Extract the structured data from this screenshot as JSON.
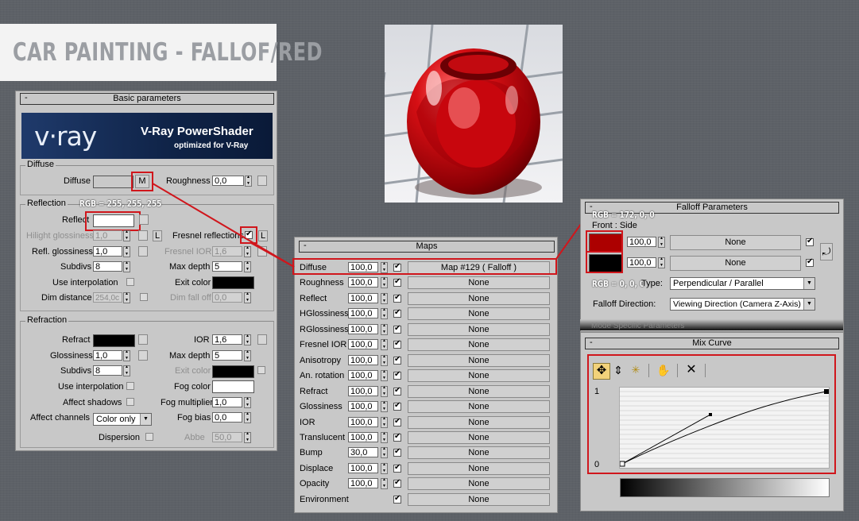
{
  "page_title": "CAR PAINTING - FALLOF/RED",
  "basic": {
    "header": "Basic parameters",
    "collapse": "-",
    "banner": {
      "logo": "v·ray",
      "title": "V-Ray PowerShader",
      "subtitle": "optimized for V-Ray"
    },
    "diffuse": {
      "group": "Diffuse",
      "label": "Diffuse",
      "map_btn": "M",
      "roughness_label": "Roughness",
      "roughness": "0,0"
    },
    "reflection": {
      "group": "Reflection",
      "rgb_note": "RGB = 255, 255, 255",
      "reflect_label": "Reflect",
      "hilight_label": "Hilight glossiness",
      "hilight": "1,0",
      "lock": "L",
      "fresnel_label": "Fresnel reflections",
      "fresnel_lock": "L",
      "refl_gloss_label": "Refl. glossiness",
      "refl_gloss": "1,0",
      "fresnel_ior_label": "Fresnel IOR",
      "fresnel_ior": "1,6",
      "subdivs_label": "Subdivs",
      "subdivs": "8",
      "max_depth_label": "Max depth",
      "max_depth": "5",
      "use_interp_label": "Use interpolation",
      "exit_color_label": "Exit color",
      "dim_dist_label": "Dim distance",
      "dim_dist": "254,0c",
      "dim_falloff_label": "Dim fall off",
      "dim_falloff": "0,0"
    },
    "refraction": {
      "group": "Refraction",
      "refract_label": "Refract",
      "ior_label": "IOR",
      "ior": "1,6",
      "gloss_label": "Glossiness",
      "gloss": "1,0",
      "max_depth_label": "Max depth",
      "max_depth": "5",
      "subdivs_label": "Subdivs",
      "subdivs": "8",
      "exit_color_label": "Exit color",
      "use_interp_label": "Use interpolation",
      "fog_color_label": "Fog color",
      "affect_shadows_label": "Affect shadows",
      "fog_mult_label": "Fog multiplier",
      "fog_mult": "1,0",
      "affect_channels_label": "Affect channels",
      "affect_channels": "Color only",
      "fog_bias_label": "Fog bias",
      "fog_bias": "0,0",
      "dispersion_label": "Dispersion",
      "abbe_label": "Abbe",
      "abbe": "50,0"
    }
  },
  "maps": {
    "header": "Maps",
    "collapse": "-",
    "rows": [
      {
        "label": "Diffuse",
        "amount": "100,0",
        "map": "Map #129  ( Falloff )"
      },
      {
        "label": "Roughness",
        "amount": "100,0",
        "map": "None"
      },
      {
        "label": "Reflect",
        "amount": "100,0",
        "map": "None"
      },
      {
        "label": "HGlossiness",
        "amount": "100,0",
        "map": "None"
      },
      {
        "label": "RGlossiness",
        "amount": "100,0",
        "map": "None"
      },
      {
        "label": "Fresnel IOR",
        "amount": "100,0",
        "map": "None"
      },
      {
        "label": "Anisotropy",
        "amount": "100,0",
        "map": "None"
      },
      {
        "label": "An. rotation",
        "amount": "100,0",
        "map": "None"
      },
      {
        "label": "Refract",
        "amount": "100,0",
        "map": "None"
      },
      {
        "label": "Glossiness",
        "amount": "100,0",
        "map": "None"
      },
      {
        "label": "IOR",
        "amount": "100,0",
        "map": "None"
      },
      {
        "label": "Translucent",
        "amount": "100,0",
        "map": "None"
      },
      {
        "label": "Bump",
        "amount": "30,0",
        "map": "None"
      },
      {
        "label": "Displace",
        "amount": "100,0",
        "map": "None"
      },
      {
        "label": "Opacity",
        "amount": "100,0",
        "map": "None"
      },
      {
        "label": "Environment",
        "amount": "",
        "map": "None"
      }
    ]
  },
  "falloff": {
    "header": "Falloff Parameters",
    "collapse": "-",
    "rgb_note_top": "RGB = 172, 0, 0",
    "front_side_label": "Front : Side",
    "front_amount": "100,0",
    "front_map": "None",
    "side_amount": "100,0",
    "side_map": "None",
    "rgb_note_bottom": "RGB = 0, 0, 0",
    "type_label": "Type:",
    "type_value": "Perpendicular / Parallel",
    "direction_label": "Falloff Direction:",
    "direction_value": "Viewing Direction (Camera Z-Axis)",
    "mode_label": "Mode Specific Parameters"
  },
  "mixcurve": {
    "header": "Mix Curve",
    "collapse": "-",
    "y_top": "1",
    "y_bottom": "0"
  },
  "colors": {
    "front_swatch": "#ac0000",
    "side_swatch": "#000000",
    "reflect_swatch": "#ffffff",
    "highlight_red": "#d0161c"
  }
}
